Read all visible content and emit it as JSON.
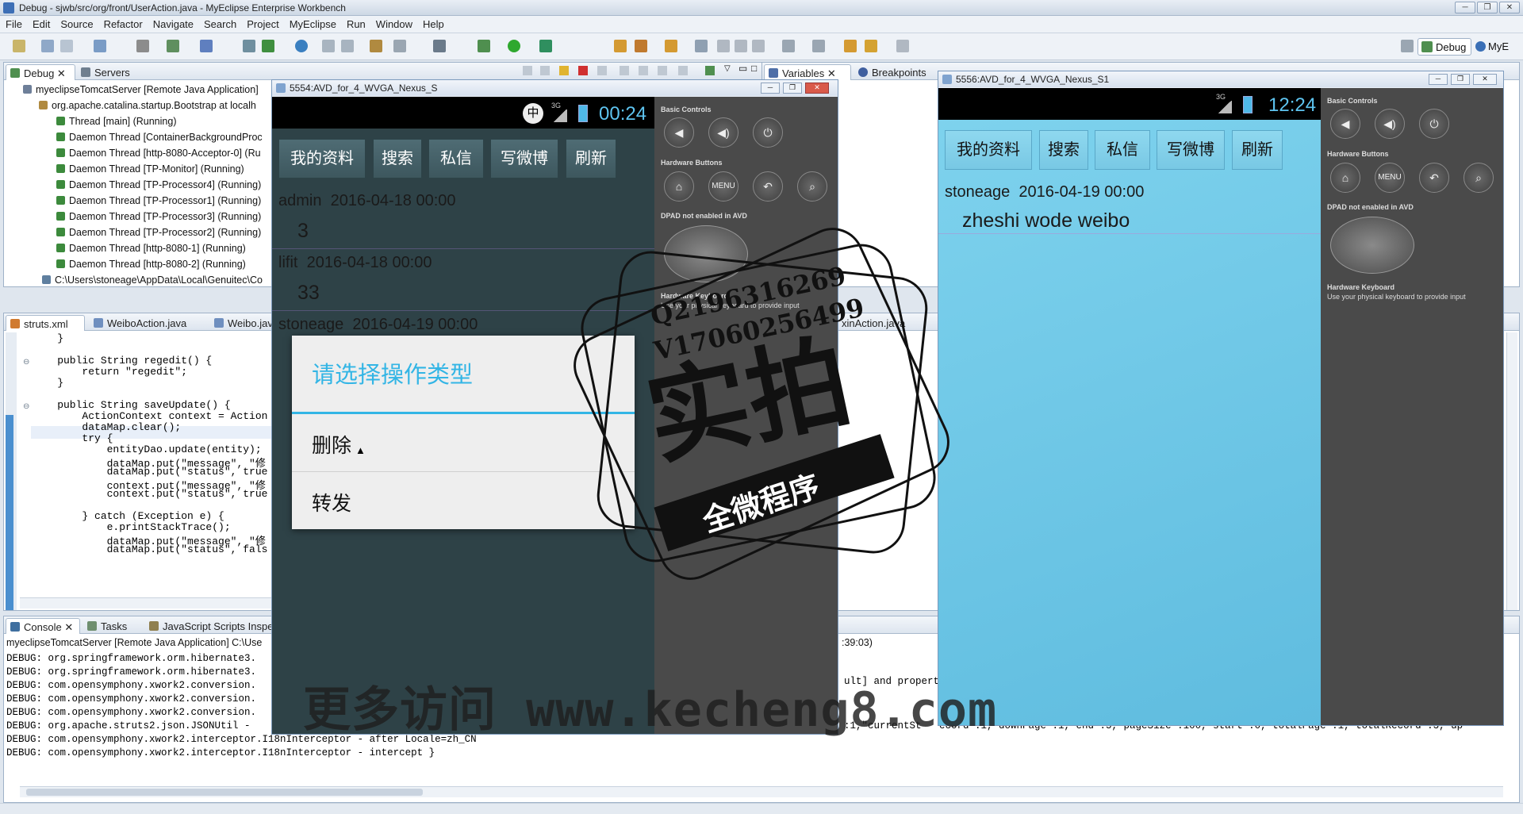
{
  "window": {
    "title": "Debug - sjwb/src/org/front/UserAction.java - MyEclipse Enterprise Workbench",
    "btn_min": "─",
    "btn_max": "❐",
    "btn_close": "✕"
  },
  "menu": [
    "File",
    "Edit",
    "Source",
    "Refactor",
    "Navigate",
    "Search",
    "Project",
    "MyEclipse",
    "Run",
    "Window",
    "Help"
  ],
  "perspectives": {
    "debug": "Debug",
    "mye": "MyE"
  },
  "debug_view": {
    "tabs": [
      {
        "label": "Debug"
      },
      {
        "label": "Servers"
      }
    ],
    "tree": [
      "myeclipseTomcatServer [Remote Java Application]",
      "org.apache.catalina.startup.Bootstrap at localh",
      "Thread [main] (Running)",
      "Daemon Thread [ContainerBackgroundProc",
      "Daemon Thread [http-8080-Acceptor-0] (Ru",
      "Daemon Thread [TP-Monitor] (Running)",
      "Daemon Thread [TP-Processor4] (Running)",
      "Daemon Thread [TP-Processor1] (Running)",
      "Daemon Thread [TP-Processor3] (Running)",
      "Daemon Thread [TP-Processor2] (Running)",
      "Daemon Thread [http-8080-1] (Running)",
      "Daemon Thread [http-8080-2] (Running)",
      "C:\\Users\\stoneage\\AppData\\Local\\Genuitec\\Co"
    ]
  },
  "variables_view": {
    "tabs": [
      {
        "label": "Variables"
      },
      {
        "label": "Breakpoints"
      }
    ]
  },
  "editor": {
    "tabs": [
      {
        "label": "struts.xml"
      },
      {
        "label": "WeiboAction.java"
      },
      {
        "label": "Weibo.jav"
      },
      {
        "label": "xinAction.java"
      }
    ],
    "lines": [
      "    }",
      "",
      "    public String regedit() {",
      "        return \"regedit\";",
      "    }",
      "",
      "    public String saveUpdate() {",
      "        ActionContext context = Action",
      "        dataMap.clear();",
      "        try {",
      "            entityDao.update(entity);",
      "            dataMap.put(\"message\", \"修",
      "            dataMap.put(\"status\", true",
      "            context.put(\"message\", \"修",
      "            context.put(\"status\", true",
      "",
      "        } catch (Exception e) {",
      "            e.printStackTrace();",
      "            dataMap.put(\"message\", \"修",
      "            dataMap.put(\"status\", fals"
    ]
  },
  "console": {
    "tabs": [
      {
        "label": "Console"
      },
      {
        "label": "Tasks"
      },
      {
        "label": "JavaScript Scripts Inspec"
      }
    ],
    "header": "myeclipseTomcatServer [Remote Java Application] C:\\Use",
    "header_right": ":39:03)",
    "lines": [
      "DEBUG: org.springframework.orm.hibernate3.",
      "DEBUG: org.springframework.orm.hibernate3.",
      "DEBUG: com.opensymphony.xwork2.conversion.",
      "DEBUG: com.opensymphony.xwork2.conversion.",
      "DEBUG: com.opensymphony.xwork2.conversion.",
      "DEBUG: org.apache.struts2.json.JSONUtil - ",
      "DEBUG: com.opensymphony.xwork2.interceptor.I18nInterceptor - after Locale=zh_CN",
      "DEBUG: com.opensymphony.xwork2.interceptor.I18nInterceptor - intercept }"
    ],
    "right_fragments": [
      "ult] and propert",
      ":1,\"currentSt   ecord\":1, downPage\":1, end\":5, pageSize\":100, start\":0, totalPage\":1, totalRecord\":3, up"
    ]
  },
  "emulator1": {
    "title": "5554:AVD_for_4_WVGA_Nexus_S",
    "status": {
      "ime": "中",
      "network": "3G",
      "time": "00:24"
    },
    "nav_buttons": [
      "我的资料",
      "搜索",
      "私信",
      "写微博",
      "刷新"
    ],
    "posts": [
      {
        "user": "admin",
        "date": "2016-04-18 00:00",
        "content": "3"
      },
      {
        "user": "lifit",
        "date": "2016-04-18 00:00",
        "content": "33"
      },
      {
        "user": "stoneage",
        "date": "2016-04-19 00:00",
        "content": ""
      }
    ],
    "dialog": {
      "title": "请选择操作类型",
      "items": [
        "删除",
        "转发"
      ]
    },
    "controls": {
      "basic": "Basic Controls",
      "hardware": "Hardware Buttons",
      "menu": "MENU",
      "dpad": "DPAD not enabled in AVD",
      "keyboard": "Hardware Keyboard",
      "keyboard_hint": "Use your physical keyboard to provide input"
    }
  },
  "emulator2": {
    "title": "5556:AVD_for_4_WVGA_Nexus_S1",
    "status": {
      "network": "3G",
      "time": "12:24"
    },
    "nav_buttons": [
      "我的资料",
      "搜索",
      "私信",
      "写微博",
      "刷新"
    ],
    "posts": [
      {
        "user": "stoneage",
        "date": "2016-04-19 00:00",
        "content": "zheshi wode weibo"
      }
    ],
    "controls": {
      "basic": "Basic Controls",
      "hardware": "Hardware Buttons",
      "menu": "MENU",
      "dpad": "DPAD not enabled in AVD",
      "keyboard": "Hardware Keyboard",
      "keyboard_hint": "Use your physical keyboard to provide input"
    }
  },
  "watermark": {
    "qq": "Q2196316269",
    "phone": "V17060256499",
    "big": "实拍",
    "banner": "全微程序",
    "site": "更多访问 www.kecheng8.com"
  },
  "colors": {
    "accent": "#33b5e5",
    "kw": "#7f0055",
    "str": "#2a00ff"
  }
}
